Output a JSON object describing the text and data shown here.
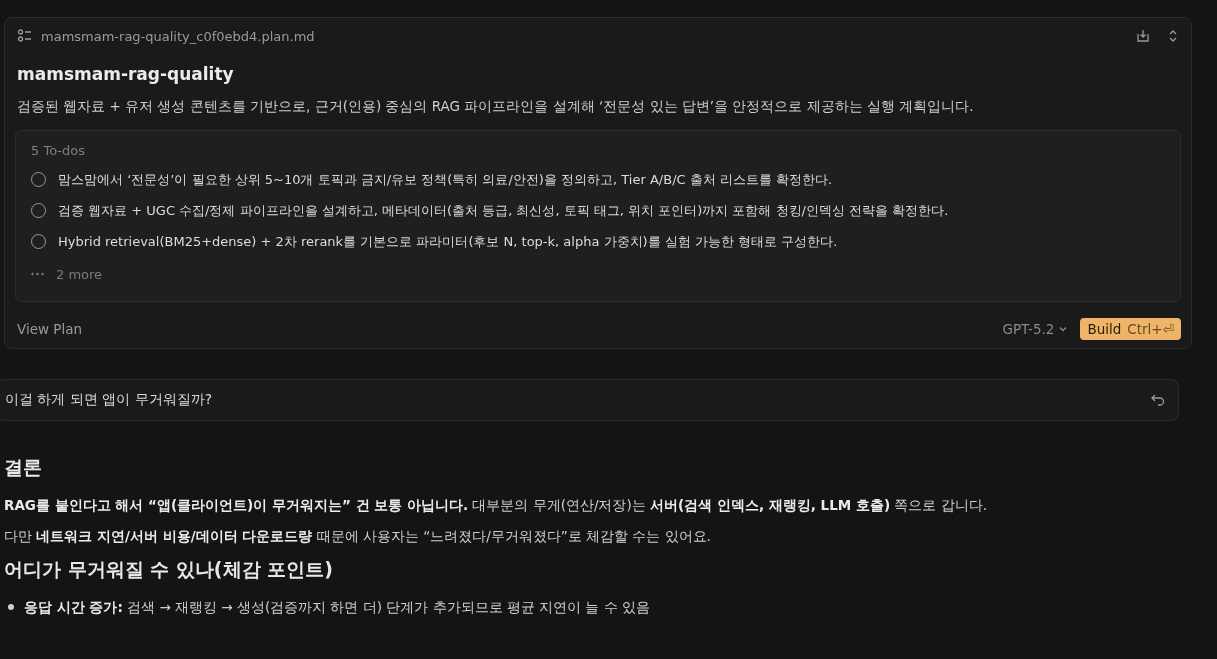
{
  "plan_card": {
    "filename": "mamsmam-rag-quality_c0f0ebd4.plan.md",
    "title": "mamsmam-rag-quality",
    "summary": "검증된 웹자료 + 유저 생성 콘텐츠를 기반으로, 근거(인용) 중심의 RAG 파이프라인을 설계해 ‘전문성 있는 답변’을 안정적으로 제공하는 실행 계획입니다.",
    "todos": {
      "heading": "5 To-dos",
      "items": [
        {
          "text": "맘스맘에서 ‘전문성’이 필요한 상위 5~10개 토픽과 금지/유보 정책(특히 의료/안전)을 정의하고, Tier A/B/C 출처 리스트를 확정한다.",
          "checked": false
        },
        {
          "text": "검증 웹자료 + UGC 수집/정제 파이프라인을 설계하고, 메타데이터(출처 등급, 최신성, 토픽 태그, 위치 포인터)까지 포함해 청킹/인덱싱 전략을 확정한다.",
          "checked": false
        },
        {
          "text": "Hybrid retrieval(BM25+dense) + 2차 rerank를 기본으로 파라미터(후보 N, top-k, alpha 가중치)를 실험 가능한 형태로 구성한다.",
          "checked": false
        }
      ],
      "more": "2 more"
    },
    "view_plan": "View Plan",
    "model": "GPT-5.2",
    "build": {
      "label": "Build",
      "shortcut": "Ctrl+⏎"
    }
  },
  "user_message": "이걸 하게 되면 앱이 무거워질까?",
  "answer": [
    {
      "kind": "heading",
      "text": "결론"
    },
    {
      "kind": "paragraph",
      "text": "**RAG를 붙인다고 해서 “앱(클라이언트)이 무거워지는” 건 보통 아닙니다.** 대부분의 무게(연산/저장)는 **서버(검색 인덱스, 재랭킹, LLM 호출)** 쪽으로 갑니다."
    },
    {
      "kind": "paragraph",
      "text": "다만 **네트워크 지연/서버 비용/데이터 다운로드량** 때문에 사용자는 “느려졌다/무거워졌다”로 체감할 수는 있어요."
    },
    {
      "kind": "heading",
      "text": "어디가 무거워질 수 있나(체감 포인트)"
    },
    {
      "kind": "bullet",
      "text": "**응답 시간 증가:** 검색 → 재랭킹 → 생성(검증까지 하면 더) 단계가 추가되므로 평균 지연이 늘 수 있음"
    }
  ]
}
